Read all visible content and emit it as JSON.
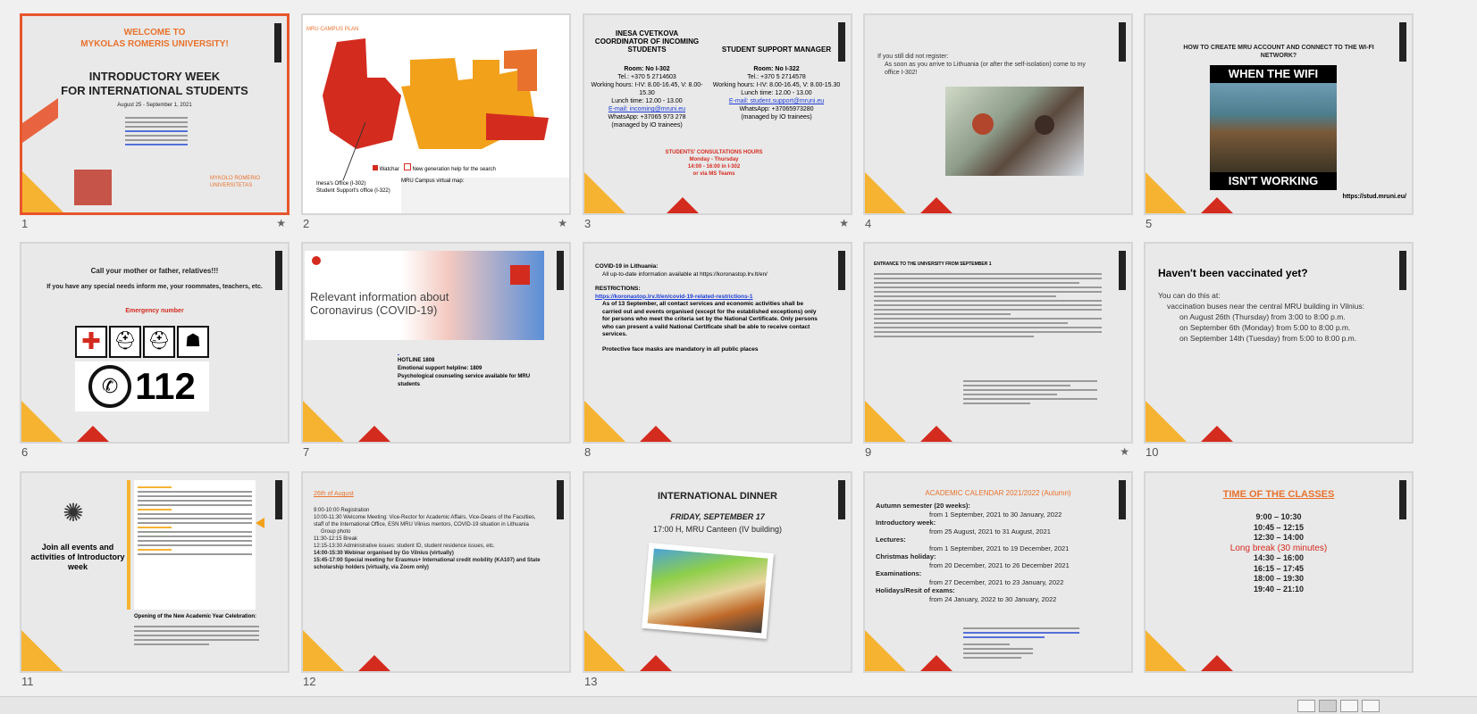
{
  "slides": [
    {
      "num": "1",
      "star": "★",
      "lines": [
        "WELCOME TO",
        "MYKOLAS ROMERIS UNIVERSITY!",
        "INTRODUCTORY WEEK",
        "FOR INTERNATIONAL STUDENTS",
        "August 25 - September 1, 2021",
        "MYKOLO ROMERIO UNIVERSITETAS"
      ]
    },
    {
      "num": "2",
      "star": "★",
      "lines": [
        "MRU CAMPUS PLAN",
        "Inesa's Office (I-302)",
        "Student Support's office (I-322)",
        "Watchar",
        "New generation help for the search",
        "MRU Campus virtual map:"
      ]
    },
    {
      "num": "3",
      "star": "★",
      "lines": [
        "INESA CVETKOVA",
        "COORDINATOR OF INCOMING STUDENTS",
        "STUDENT SUPPORT MANAGER",
        "Room: No I-302",
        "Tel.: +370 5 2714603",
        "Working hours: I-IV: 8.00-16.45, V: 8.00-15.30",
        "Lunch time: 12.00 - 13.00",
        "E-mail: incoming@mruni.eu",
        "WhatsApp: +37065 973 278",
        "(managed by IO trainees)",
        "Room: No I-322",
        "Tel.: +370 5 2714578",
        "Working hours: I-IV: 8.00-16.45, V: 8.00-15.30",
        "Lunch time: 12.00 - 13.00",
        "E-mail: student.support@mruni.eu",
        "WhatsApp: +37065973280",
        "(managed by IO trainees)",
        "STUDENTS' CONSULTATIONS HOURS",
        "Monday - Thursday",
        "14:00 - 16:00 in I-302",
        "or via MS Teams"
      ]
    },
    {
      "num": "4",
      "star": "",
      "lines": [
        "If you still did not register:",
        "As soon as you arrive to Lithuania (or after the self-isolation) come to my office I-302!"
      ]
    },
    {
      "num": "5",
      "star": "",
      "lines": [
        "HOW TO CREATE MRU ACCOUNT AND CONNECT TO THE WI-FI NETWORK?",
        "WHEN THE WIFI",
        "ISN'T WORKING",
        "https://stud.mruni.eu/"
      ]
    },
    {
      "num": "6",
      "star": "",
      "lines": [
        "Call your mother or father, relatives!!!",
        "If you have any special needs inform me, your roommates, teachers, etc.",
        "Emergency number",
        "112"
      ]
    },
    {
      "num": "7",
      "star": "",
      "lines": [
        "Relevant information about",
        "Coronavirus (COVID-19)",
        "HOTLINE 1808",
        "Emotional support helpline: 1809",
        "Psychological counseling service available for MRU students"
      ]
    },
    {
      "num": "8",
      "star": "",
      "lines": [
        "COVID-19 in Lithuania:",
        "All up-to-date information available at https://koronastop.lrv.lt/en/",
        "RESTRICTIONS:",
        "https://koronastop.lrv.lt/en/covid-19-related-restrictions-1",
        "As of 13 September, all contact services and economic activities shall be carried out and events organised (except for the established exceptions) only for persons who meet the criteria set by the National Certificate. Only persons who can present a valid National Certificate shall be able to receive contact services.",
        "Protective face masks are mandatory in all public places"
      ]
    },
    {
      "num": "9",
      "star": "★",
      "lines": [
        "ENTRANCE TO THE UNIVERSITY FROM SEPTEMBER 1"
      ]
    },
    {
      "num": "10",
      "star": "",
      "lines": [
        "Haven't been vaccinated yet?",
        "You can do this at:",
        "vaccination buses near the central MRU building in Vilnius:",
        "on August 26th (Thursday) from 3:00 to 8:00 p.m.",
        "on September 6th (Monday) from 5:00 to 8:00 p.m.",
        "on September 14th (Tuesday) from 5:00 to 8:00 p.m."
      ]
    },
    {
      "num": "11",
      "star": "",
      "lines": [
        "Join all events and activities of Introductory week",
        "Opening of the New Academic Year Celebration:"
      ]
    },
    {
      "num": "12",
      "star": "",
      "lines": [
        "26th of August",
        "9:00-10:00 Registration",
        "10:00-11:30 Welcome Meeting: Vice-Rector for Academic Affairs, Vice-Deans of the Faculties, staff of the International Office, ESN MRU Vilnius mentors, COVID-19 situation in Lithuania",
        "Group photo",
        "11:30-12:15 Break",
        "12:15-13:30 Administrative issues: student ID, student residence issues, etc.",
        "14:00-15:30 Webinar organised by Go Vilnius (virtually)",
        "15:45-17:00 Special meeting for Erasmus+ International credit mobility (KA107) and State scholarship holders (virtually, via Zoom only)"
      ]
    },
    {
      "num": "13",
      "star": "",
      "lines": [
        "INTERNATIONAL DINNER",
        "FRIDAY, SEPTEMBER 17",
        "17:00 H, MRU Canteen (IV building)"
      ]
    },
    {
      "num": "14",
      "star": "",
      "lines": [
        "ACADEMIC CALENDAR 2021/2022 (Autumn)",
        "Autumn semester (20 weeks):",
        "from 1 September, 2021 to 30 January, 2022",
        "Introductory week:",
        "from 25 August, 2021 to 31 August, 2021",
        "Lectures:",
        "from 1 September, 2021 to 19 December, 2021",
        "Christmas holiday:",
        "from 20 December, 2021 to 26 December 2021",
        "Examinations:",
        "from 27 December, 2021 to 23 January, 2022",
        "Holidays/Resit of exams:",
        "from 24 January, 2022 to 30 January, 2022"
      ]
    },
    {
      "num": "15",
      "star": "",
      "lines": [
        "TIME OF THE CLASSES",
        "9:00 – 10:30",
        "10:45 – 12:15",
        "12:30 – 14:00",
        "Long break (30 minutes)",
        "14:30 – 16:00",
        "16:15 – 17:45",
        "18:00 – 19:30",
        "19:40 – 21:10"
      ]
    }
  ]
}
